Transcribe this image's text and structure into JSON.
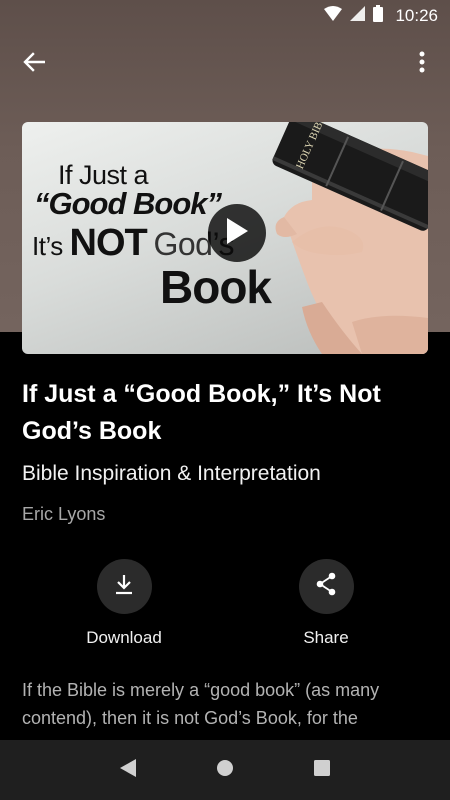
{
  "status": {
    "time": "10:26"
  },
  "app_bar": {
    "back_icon": "arrow-left-icon",
    "more_icon": "more-vert-icon"
  },
  "thumbnail": {
    "line1": "If Just a",
    "line2": "“Good Book”",
    "line3_prefix": "It’s",
    "line3_bold": "NOT",
    "line3_ghost": "God’s",
    "line4": "Book",
    "book_spine": "HOLY BIBLE",
    "play_icon": "play-icon"
  },
  "article": {
    "title": "If Just a “Good Book,” It’s Not God’s Book",
    "category": "Bible Inspiration & Interpretation",
    "author": "Eric Lyons",
    "description": "If the Bible is merely a “good book” (as many contend), then it is not God’s Book, for the"
  },
  "actions": [
    {
      "label": "Download",
      "icon": "download-icon"
    },
    {
      "label": "Share",
      "icon": "share-icon"
    }
  ],
  "nav": {
    "back": "nav-back-icon",
    "home": "nav-home-icon",
    "recents": "nav-recents-icon"
  }
}
